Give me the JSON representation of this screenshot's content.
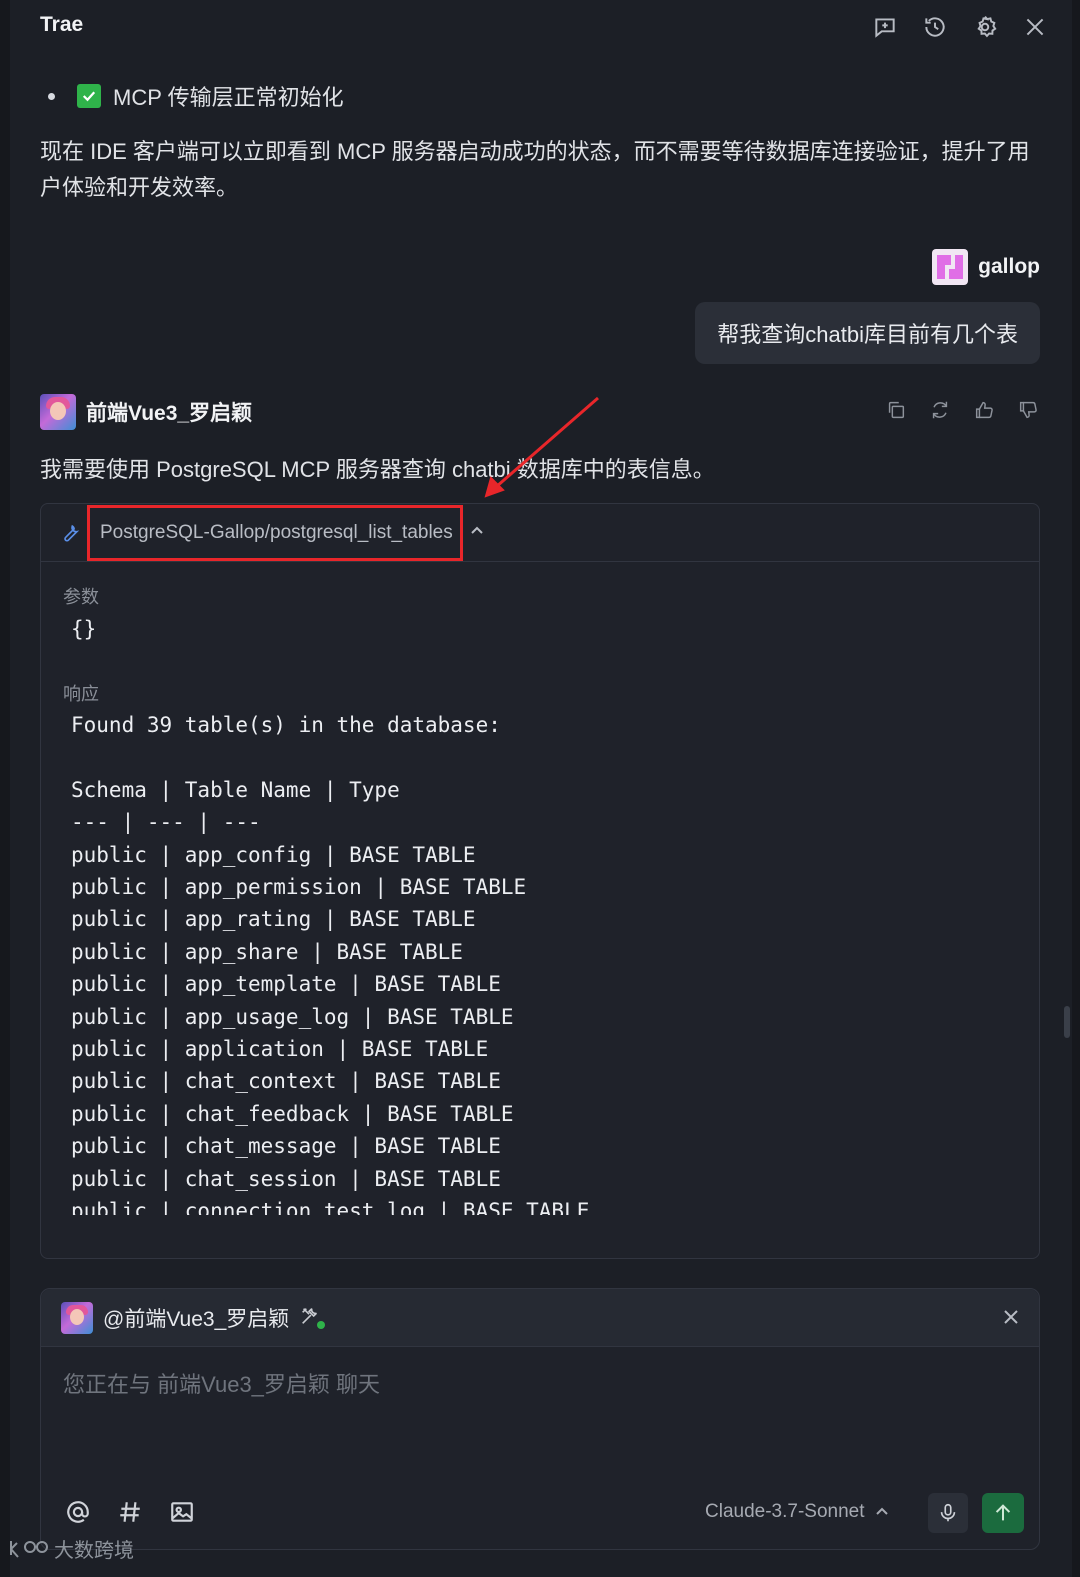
{
  "app": {
    "title": "Trae"
  },
  "header": {
    "icons": [
      "new-chat-icon",
      "history-icon",
      "gear-icon",
      "close-icon"
    ]
  },
  "content": {
    "bullet": "MCP 传输层正常初始化",
    "paragraph": "现在 IDE 客户端可以立即看到 MCP 服务器启动成功的状态，而不需要等待数据库连接验证，提升了用户体验和开发效率。"
  },
  "user": {
    "name": "gallop",
    "message": "帮我查询chatbi库目前有几个表"
  },
  "agent": {
    "name": "前端Vue3_罗启颖",
    "message": "我需要使用 PostgreSQL MCP 服务器查询 chatbi 数据库中的表信息。",
    "actions": [
      "copy-icon",
      "refresh-icon",
      "thumbs-up-icon",
      "thumbs-down-icon"
    ]
  },
  "tool_call": {
    "name": "PostgreSQL-Gallop/postgresql_list_tables",
    "params_label": "参数",
    "params_value": "{}",
    "response_label": "响应",
    "response_lines": [
      "Found 39 table(s) in the database:",
      "",
      "Schema | Table Name | Type",
      "--- | --- | ---",
      "public | app_config | BASE TABLE",
      "public | app_permission | BASE TABLE",
      "public | app_rating | BASE TABLE",
      "public | app_share | BASE TABLE",
      "public | app_template | BASE TABLE",
      "public | app_usage_log | BASE TABLE",
      "public | application | BASE TABLE",
      "public | chat_context | BASE TABLE",
      "public | chat_feedback | BASE TABLE",
      "public | chat_message | BASE TABLE",
      "public | chat_session | BASE TABLE",
      "public | connection_test_log | BASE TABLE"
    ]
  },
  "input": {
    "mention": "@前端Vue3_罗启颖",
    "placeholder": "您正在与 前端Vue3_罗启颖 聊天",
    "value": "",
    "model": "Claude-3.7-Sonnet",
    "tools": [
      "at-icon",
      "hash-icon",
      "image-icon"
    ]
  },
  "watermark": {
    "text": "大数跨境"
  },
  "colors": {
    "background": "#1c1f26",
    "highlight_box": "#e8262a",
    "send_button": "#1b6b3e",
    "check": "#2fb34a",
    "link_icon": "#5a8fe8"
  }
}
